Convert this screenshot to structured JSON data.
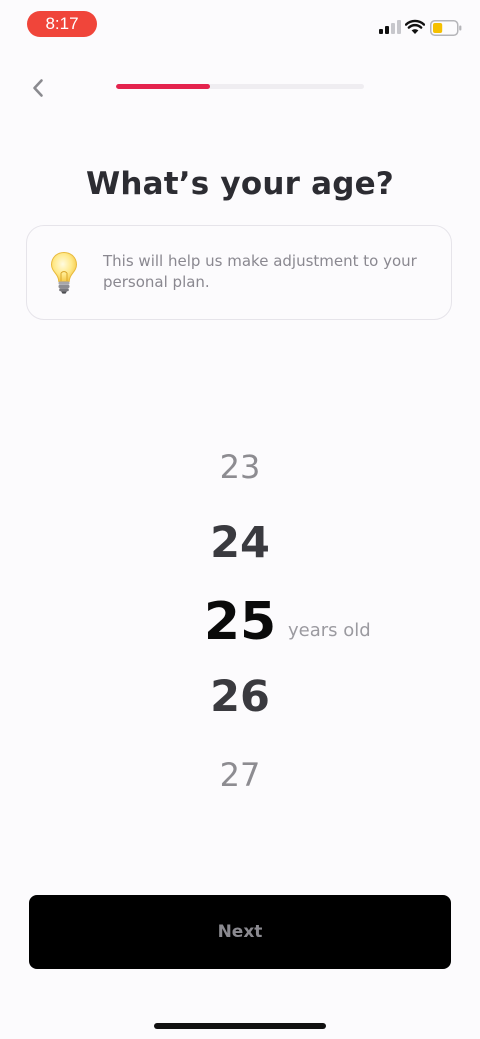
{
  "status_bar": {
    "time": "8:17",
    "time_pill_color": "#f0453a",
    "signal_icon": "cellular-signal-icon",
    "wifi_icon": "wifi-icon",
    "battery_icon": "battery-icon",
    "battery_level": 0.4,
    "battery_color": "#f5c000"
  },
  "header": {
    "back_icon": "chevron-left-icon",
    "progress": 0.38,
    "progress_color": "#e4234d"
  },
  "title": "What’s your age?",
  "info_card": {
    "icon": "lightbulb-icon",
    "text": "This will help us make adjustment to your personal plan."
  },
  "picker": {
    "items": [
      "23",
      "24",
      "25",
      "26",
      "27"
    ],
    "selected": "25",
    "unit": "years old"
  },
  "next_button": {
    "label": "Next",
    "background": "#000000"
  }
}
